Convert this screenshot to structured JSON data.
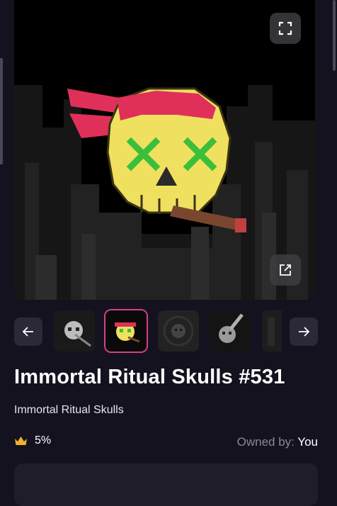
{
  "nft": {
    "title": "Immortal Ritual Skulls #531",
    "collection": "Immortal Ritual Skulls",
    "rarity": "5%",
    "owned_label": "Owned by:",
    "owner": "You"
  },
  "icons": {
    "fullscreen": "fullscreen-icon",
    "external": "external-link-icon",
    "prev": "arrow-left-icon",
    "next": "arrow-right-icon",
    "rarity": "crown-icon"
  },
  "carousel": {
    "selected_index": 1,
    "thumbnail_count": 5
  },
  "colors": {
    "background": "#15121f",
    "accent_selected": "#d63f8a",
    "crown": "#f0b429"
  }
}
